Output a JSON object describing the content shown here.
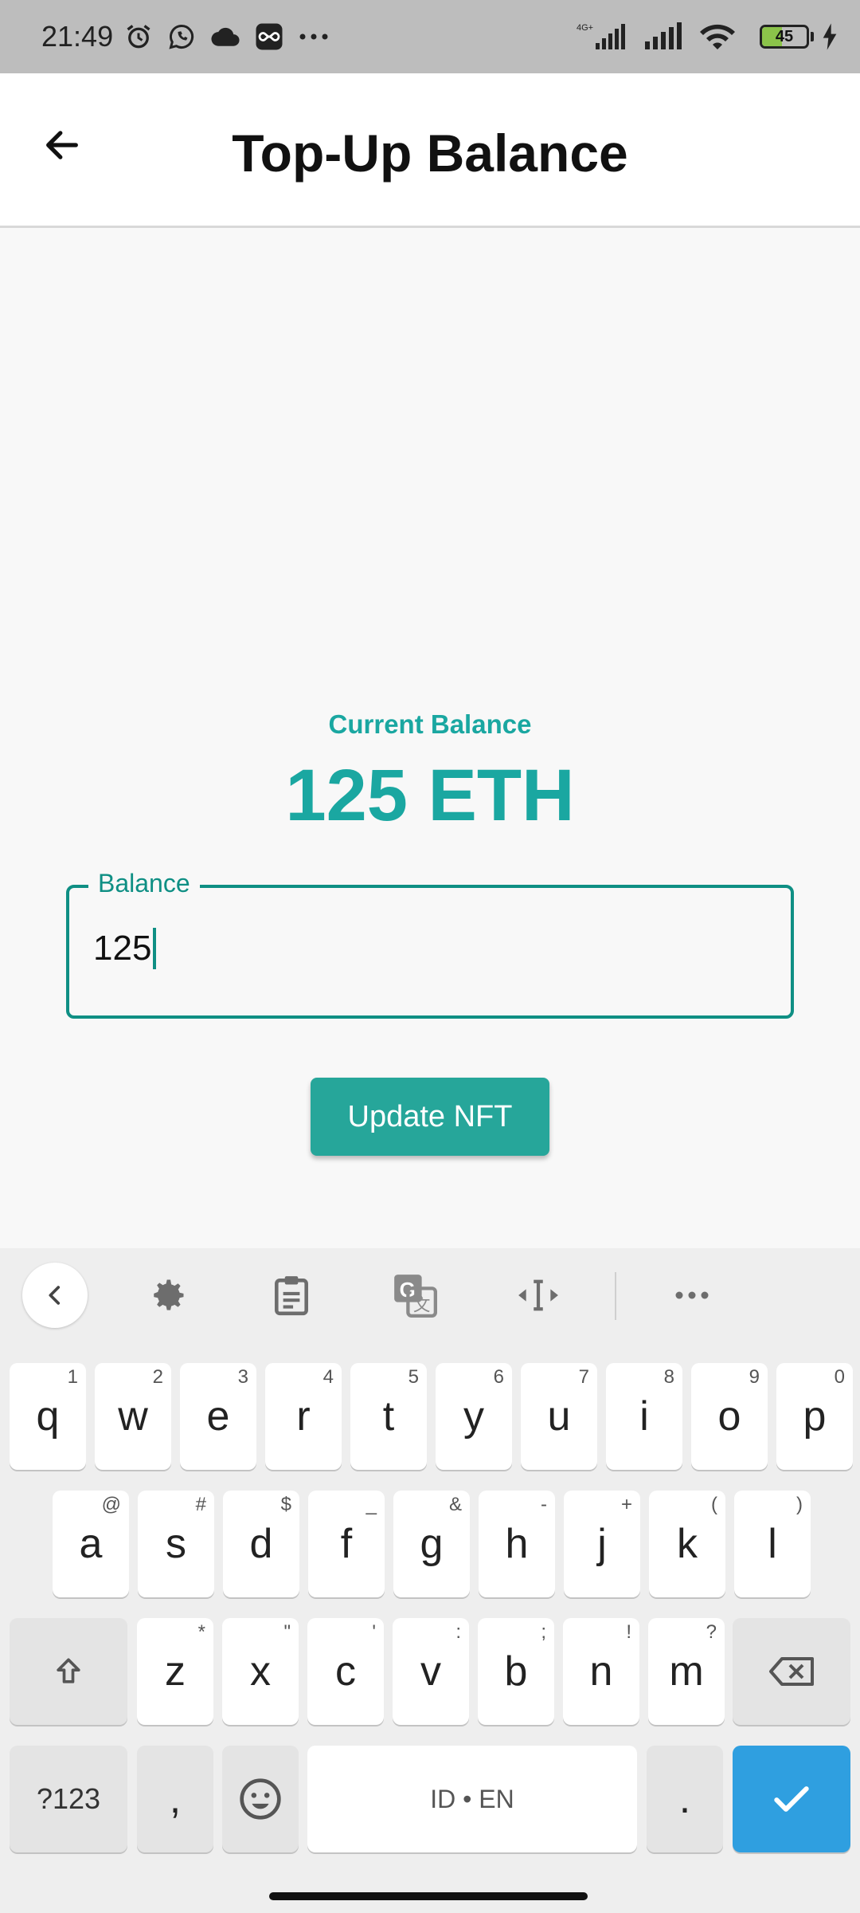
{
  "status_bar": {
    "time": "21:49",
    "battery_level": "45",
    "icons": [
      "alarm-icon",
      "whatsapp-icon",
      "cloud-icon",
      "infinity-icon",
      "more-dots-icon",
      "signal-4g-icon",
      "signal-icon",
      "wifi-icon",
      "battery-icon",
      "charging-icon"
    ],
    "network_label": "4G+"
  },
  "app_bar": {
    "title": "Top-Up Balance",
    "back_icon": "arrow-left-icon"
  },
  "balance": {
    "label": "Current Balance",
    "value": "125 ETH",
    "accent_color": "#1aa7a1"
  },
  "field": {
    "label": "Balance",
    "value": "125",
    "border_color": "#0f8f84"
  },
  "update_button": {
    "label": "Update NFT",
    "color": "#26a69a"
  },
  "keyboard": {
    "toolbar": [
      "chevron-left-icon",
      "gear-icon",
      "clipboard-icon",
      "translate-icon",
      "cursor-move-icon",
      "more-dots-icon"
    ],
    "row1": [
      {
        "k": "q",
        "h": "1"
      },
      {
        "k": "w",
        "h": "2"
      },
      {
        "k": "e",
        "h": "3"
      },
      {
        "k": "r",
        "h": "4"
      },
      {
        "k": "t",
        "h": "5"
      },
      {
        "k": "y",
        "h": "6"
      },
      {
        "k": "u",
        "h": "7"
      },
      {
        "k": "i",
        "h": "8"
      },
      {
        "k": "o",
        "h": "9"
      },
      {
        "k": "p",
        "h": "0"
      }
    ],
    "row2": [
      {
        "k": "a",
        "h": "@"
      },
      {
        "k": "s",
        "h": "#"
      },
      {
        "k": "d",
        "h": "$"
      },
      {
        "k": "f",
        "h": "_"
      },
      {
        "k": "g",
        "h": "&"
      },
      {
        "k": "h",
        "h": "-"
      },
      {
        "k": "j",
        "h": "+"
      },
      {
        "k": "k",
        "h": "("
      },
      {
        "k": "l",
        "h": ")"
      }
    ],
    "row3": [
      {
        "k": "z",
        "h": "*"
      },
      {
        "k": "x",
        "h": "\""
      },
      {
        "k": "c",
        "h": "'"
      },
      {
        "k": "v",
        "h": ":"
      },
      {
        "k": "b",
        "h": ";"
      },
      {
        "k": "n",
        "h": "!"
      },
      {
        "k": "m",
        "h": "?"
      }
    ],
    "sym_label": "?123",
    "comma_label": ",",
    "space_label": "ID • EN",
    "period_label": ".",
    "enter_color": "#2f9fe0"
  }
}
